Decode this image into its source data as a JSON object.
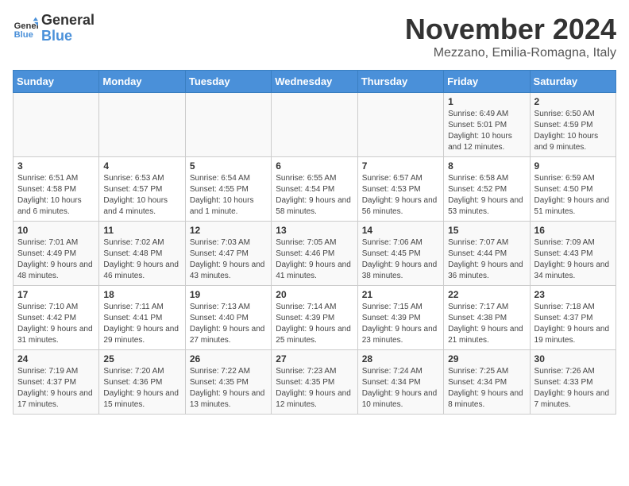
{
  "logo": {
    "general": "General",
    "blue": "Blue"
  },
  "title": "November 2024",
  "location": "Mezzano, Emilia-Romagna, Italy",
  "headers": [
    "Sunday",
    "Monday",
    "Tuesday",
    "Wednesday",
    "Thursday",
    "Friday",
    "Saturday"
  ],
  "weeks": [
    [
      {
        "day": "",
        "info": ""
      },
      {
        "day": "",
        "info": ""
      },
      {
        "day": "",
        "info": ""
      },
      {
        "day": "",
        "info": ""
      },
      {
        "day": "",
        "info": ""
      },
      {
        "day": "1",
        "info": "Sunrise: 6:49 AM\nSunset: 5:01 PM\nDaylight: 10 hours and 12 minutes."
      },
      {
        "day": "2",
        "info": "Sunrise: 6:50 AM\nSunset: 4:59 PM\nDaylight: 10 hours and 9 minutes."
      }
    ],
    [
      {
        "day": "3",
        "info": "Sunrise: 6:51 AM\nSunset: 4:58 PM\nDaylight: 10 hours and 6 minutes."
      },
      {
        "day": "4",
        "info": "Sunrise: 6:53 AM\nSunset: 4:57 PM\nDaylight: 10 hours and 4 minutes."
      },
      {
        "day": "5",
        "info": "Sunrise: 6:54 AM\nSunset: 4:55 PM\nDaylight: 10 hours and 1 minute."
      },
      {
        "day": "6",
        "info": "Sunrise: 6:55 AM\nSunset: 4:54 PM\nDaylight: 9 hours and 58 minutes."
      },
      {
        "day": "7",
        "info": "Sunrise: 6:57 AM\nSunset: 4:53 PM\nDaylight: 9 hours and 56 minutes."
      },
      {
        "day": "8",
        "info": "Sunrise: 6:58 AM\nSunset: 4:52 PM\nDaylight: 9 hours and 53 minutes."
      },
      {
        "day": "9",
        "info": "Sunrise: 6:59 AM\nSunset: 4:50 PM\nDaylight: 9 hours and 51 minutes."
      }
    ],
    [
      {
        "day": "10",
        "info": "Sunrise: 7:01 AM\nSunset: 4:49 PM\nDaylight: 9 hours and 48 minutes."
      },
      {
        "day": "11",
        "info": "Sunrise: 7:02 AM\nSunset: 4:48 PM\nDaylight: 9 hours and 46 minutes."
      },
      {
        "day": "12",
        "info": "Sunrise: 7:03 AM\nSunset: 4:47 PM\nDaylight: 9 hours and 43 minutes."
      },
      {
        "day": "13",
        "info": "Sunrise: 7:05 AM\nSunset: 4:46 PM\nDaylight: 9 hours and 41 minutes."
      },
      {
        "day": "14",
        "info": "Sunrise: 7:06 AM\nSunset: 4:45 PM\nDaylight: 9 hours and 38 minutes."
      },
      {
        "day": "15",
        "info": "Sunrise: 7:07 AM\nSunset: 4:44 PM\nDaylight: 9 hours and 36 minutes."
      },
      {
        "day": "16",
        "info": "Sunrise: 7:09 AM\nSunset: 4:43 PM\nDaylight: 9 hours and 34 minutes."
      }
    ],
    [
      {
        "day": "17",
        "info": "Sunrise: 7:10 AM\nSunset: 4:42 PM\nDaylight: 9 hours and 31 minutes."
      },
      {
        "day": "18",
        "info": "Sunrise: 7:11 AM\nSunset: 4:41 PM\nDaylight: 9 hours and 29 minutes."
      },
      {
        "day": "19",
        "info": "Sunrise: 7:13 AM\nSunset: 4:40 PM\nDaylight: 9 hours and 27 minutes."
      },
      {
        "day": "20",
        "info": "Sunrise: 7:14 AM\nSunset: 4:39 PM\nDaylight: 9 hours and 25 minutes."
      },
      {
        "day": "21",
        "info": "Sunrise: 7:15 AM\nSunset: 4:39 PM\nDaylight: 9 hours and 23 minutes."
      },
      {
        "day": "22",
        "info": "Sunrise: 7:17 AM\nSunset: 4:38 PM\nDaylight: 9 hours and 21 minutes."
      },
      {
        "day": "23",
        "info": "Sunrise: 7:18 AM\nSunset: 4:37 PM\nDaylight: 9 hours and 19 minutes."
      }
    ],
    [
      {
        "day": "24",
        "info": "Sunrise: 7:19 AM\nSunset: 4:37 PM\nDaylight: 9 hours and 17 minutes."
      },
      {
        "day": "25",
        "info": "Sunrise: 7:20 AM\nSunset: 4:36 PM\nDaylight: 9 hours and 15 minutes."
      },
      {
        "day": "26",
        "info": "Sunrise: 7:22 AM\nSunset: 4:35 PM\nDaylight: 9 hours and 13 minutes."
      },
      {
        "day": "27",
        "info": "Sunrise: 7:23 AM\nSunset: 4:35 PM\nDaylight: 9 hours and 12 minutes."
      },
      {
        "day": "28",
        "info": "Sunrise: 7:24 AM\nSunset: 4:34 PM\nDaylight: 9 hours and 10 minutes."
      },
      {
        "day": "29",
        "info": "Sunrise: 7:25 AM\nSunset: 4:34 PM\nDaylight: 9 hours and 8 minutes."
      },
      {
        "day": "30",
        "info": "Sunrise: 7:26 AM\nSunset: 4:33 PM\nDaylight: 9 hours and 7 minutes."
      }
    ]
  ]
}
